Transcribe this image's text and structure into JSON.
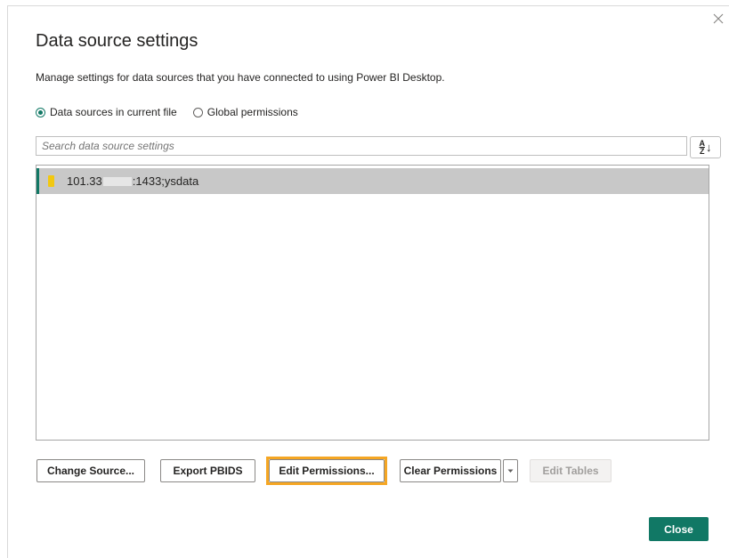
{
  "dialog": {
    "title": "Data source settings",
    "description": "Manage settings for data sources that you have connected to using Power BI Desktop.",
    "close_icon": "close-icon"
  },
  "scope": {
    "options": [
      {
        "label": "Data sources in current file",
        "selected": true
      },
      {
        "label": "Global permissions",
        "selected": false
      }
    ]
  },
  "search": {
    "placeholder": "Search data source settings",
    "sort_icon": "sort-az-icon",
    "sort_glyph_top": "A",
    "sort_glyph_mid": "Z",
    "sort_glyph_arrow": "↓"
  },
  "sources": [
    {
      "prefix": "101.33",
      "suffix": ":1433;ysdata",
      "icon": "database-icon",
      "selected": true
    }
  ],
  "actions": {
    "change_source": "Change Source...",
    "export_pbids": "Export PBIDS",
    "edit_permissions": "Edit Permissions...",
    "clear_permissions": "Clear Permissions",
    "edit_tables": "Edit Tables",
    "close": "Close"
  },
  "colors": {
    "accent": "#117865",
    "highlight": "#f5a623",
    "source_icon": "#f2c811"
  }
}
